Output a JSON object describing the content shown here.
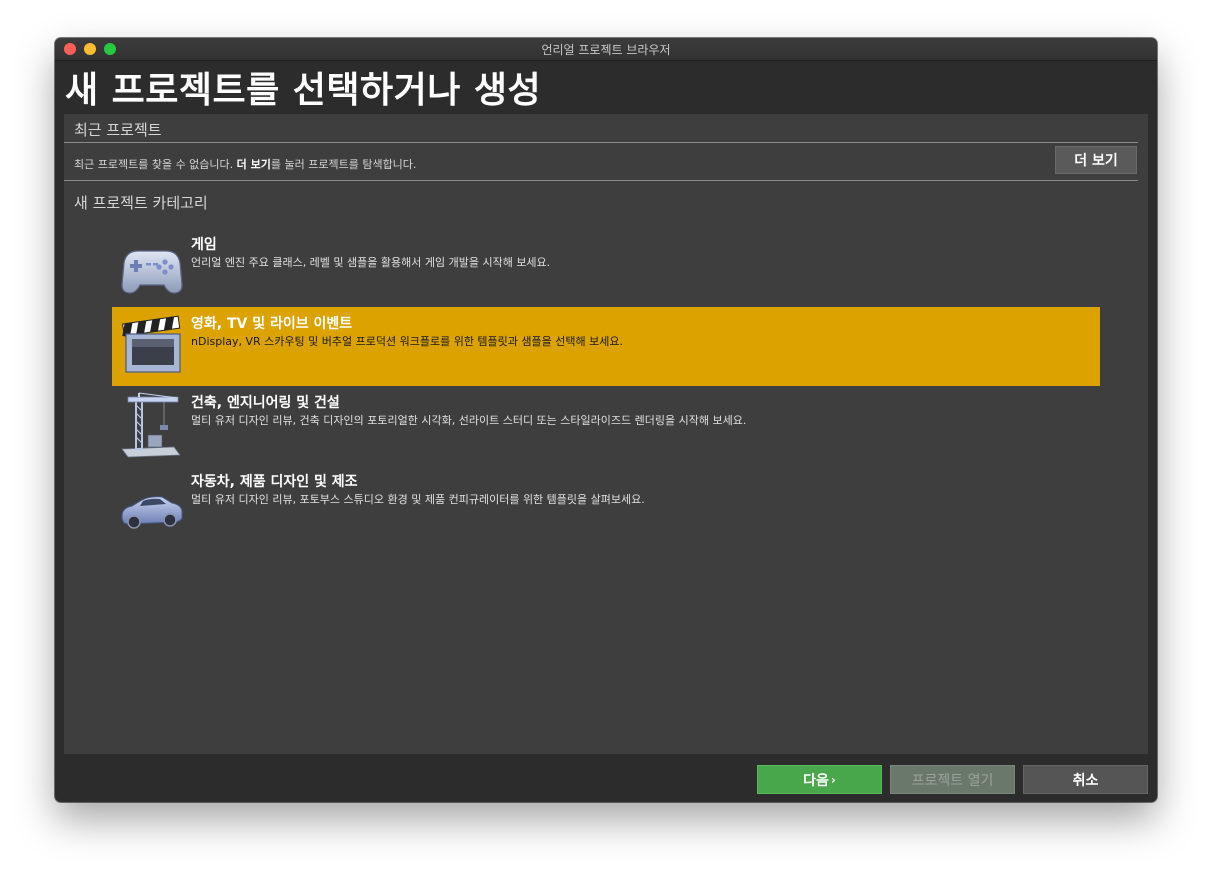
{
  "window": {
    "title": "언리얼 프로젝트 브라우저"
  },
  "page": {
    "title": "새 프로젝트를 선택하거나 생성"
  },
  "recent": {
    "header": "최근 프로젝트",
    "message_before": "최근 프로젝트를 찾을 수 없습니다. ",
    "message_bold": "더 보기",
    "message_after": "를 눌러 프로젝트를 탐색합니다.",
    "more_button": "더 보기"
  },
  "categories": {
    "header": "새 프로젝트 카테고리",
    "selected_index": 1,
    "items": [
      {
        "icon": "gamepad-icon",
        "title": "게임",
        "desc": "언리얼 엔진 주요 클래스, 레벨 및 샘플을 활용해서 게임 개발을 시작해 보세요."
      },
      {
        "icon": "clapperboard-icon",
        "title": "영화, TV 및 라이브 이벤트",
        "desc": "nDisplay, VR 스카우팅 및 버추얼 프로덕션 워크플로를 위한 템플릿과 샘플을 선택해 보세요."
      },
      {
        "icon": "crane-icon",
        "title": "건축, 엔지니어링 및 건설",
        "desc": "멀티 유저 디자인 리뷰, 건축 디자인의 포토리얼한 시각화, 선라이트 스터디 또는 스타일라이즈드 렌더링을 시작해 보세요."
      },
      {
        "icon": "car-icon",
        "title": "자동차, 제품 디자인 및 제조",
        "desc": "멀티 유저 디자인 리뷰, 포토부스 스튜디오 환경 및 제품 컨피규레이터를 위한 템플릿을 살펴보세요."
      }
    ]
  },
  "footer": {
    "next": "다음",
    "next_chevron": "›",
    "open_project": "프로젝트 열기",
    "cancel": "취소"
  },
  "colors": {
    "selected_highlight": "#dba200",
    "next_button": "#48a64b"
  }
}
